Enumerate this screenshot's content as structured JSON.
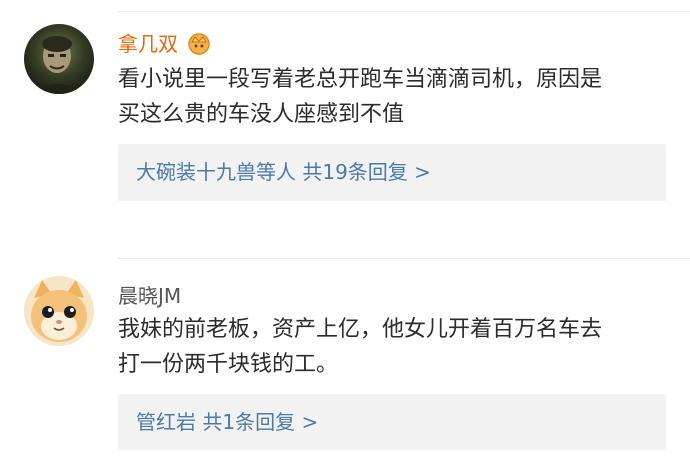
{
  "comments": [
    {
      "username": "拿几双",
      "text_line1": "看小说里一段写着老总开跑车当滴滴司机，原因是",
      "text_line2": "买这么贵的车没人座感到不值",
      "reply_summary": "大碗装十九兽等人  共19条回复",
      "reply_chevron": ">",
      "username_color": "#e36a12",
      "avatar_icon": "dark-face-avatar",
      "badge_icon": "vip-crown-badge"
    },
    {
      "username": "晨晓JM",
      "text_line1": "我妹的前老板，资产上亿，他女儿开着百万名车去",
      "text_line2": "打一份两千块钱的工。",
      "reply_summary": "管红岩  共1条回复",
      "reply_chevron": ">",
      "username_color": "#555555",
      "avatar_icon": "cat-avatar"
    }
  ],
  "colors": {
    "link": "#4a7aa8",
    "reply_bg": "#f2f2f2",
    "text": "#2b2b2b"
  }
}
